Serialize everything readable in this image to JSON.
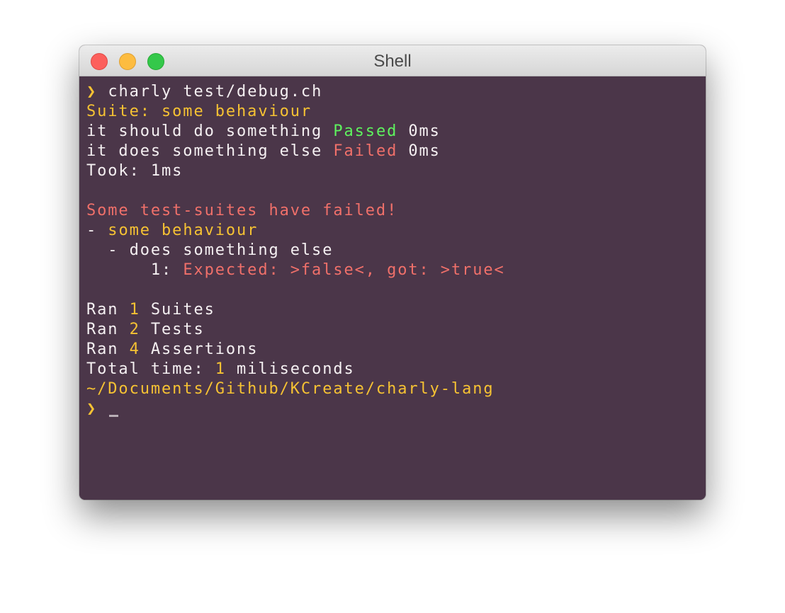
{
  "window": {
    "title": "Shell"
  },
  "terminal": {
    "prompt_symbol": "❯",
    "command": "charly test/debug.ch",
    "suite_line": "Suite: some behaviour",
    "tests": [
      {
        "name": "it should do something",
        "status": "Passed",
        "time": "0ms"
      },
      {
        "name": "it does something else",
        "status": "Failed",
        "time": "0ms"
      }
    ],
    "took": "Took: 1ms",
    "failure_header": "Some test-suites have failed!",
    "failure_suite_dash": "- ",
    "failure_suite": "some behaviour",
    "failure_test": "  - does something else",
    "failure_index": "      1: ",
    "failure_message": "Expected: >false<, got: >true<",
    "summary": [
      {
        "prefix": "Ran ",
        "count": "1",
        "suffix": " Suites"
      },
      {
        "prefix": "Ran ",
        "count": "2",
        "suffix": " Tests"
      },
      {
        "prefix": "Ran ",
        "count": "4",
        "suffix": " Assertions"
      },
      {
        "prefix": "Total time: ",
        "count": "1",
        "suffix": " miliseconds"
      }
    ],
    "cwd": "~/Documents/Github/KCreate/charly-lang"
  },
  "colors": {
    "background": "#4b3649",
    "yellow": "#f6c233",
    "green": "#5ef35e",
    "red": "#f0706a",
    "white": "#f5f0f2"
  }
}
